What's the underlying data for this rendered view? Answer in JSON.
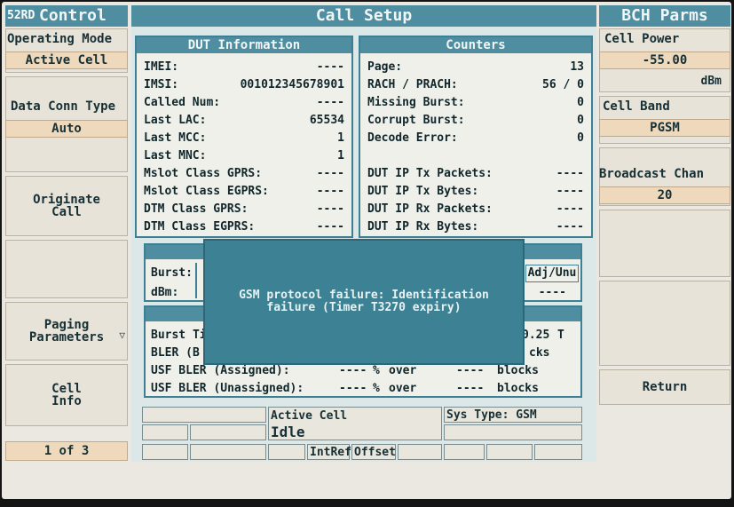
{
  "watermark": "52RD",
  "left": {
    "header": "Control",
    "operating_mode": {
      "title": "Operating Mode",
      "value": "Active Cell"
    },
    "data_conn_type": {
      "title": "Data Conn Type",
      "value": "Auto"
    },
    "originate_call": "Originate\nCall",
    "paging_parameters": "Paging\nParameters",
    "paging_more": "▽",
    "cell_info": "Cell\nInfo",
    "page_indicator": "1 of 3"
  },
  "center": {
    "header": "Call Setup",
    "dut_info": {
      "title": "DUT Information",
      "rows": [
        {
          "label": "IMEI:",
          "value": "----"
        },
        {
          "label": "IMSI:",
          "value": "001012345678901"
        },
        {
          "label": "Called Num:",
          "value": "----"
        },
        {
          "label": "Last LAC:",
          "value": "65534"
        },
        {
          "label": "Last MCC:",
          "value": "1"
        },
        {
          "label": "Last MNC:",
          "value": "1"
        },
        {
          "label": "Mslot Class GPRS:",
          "value": "----"
        },
        {
          "label": "Mslot Class EGPRS:",
          "value": "----"
        },
        {
          "label": "DTM Class GPRS:",
          "value": "----"
        },
        {
          "label": "DTM Class EGPRS:",
          "value": "----"
        }
      ]
    },
    "counters": {
      "title": "Counters",
      "rows": [
        {
          "label": "Page:",
          "value": "13"
        },
        {
          "label": "RACH / PRACH:",
          "value": "56 / 0"
        },
        {
          "label": "Missing Burst:",
          "value": "0"
        },
        {
          "label": "Corrupt Burst:",
          "value": "0"
        },
        {
          "label": "Decode Error:",
          "value": "0"
        },
        {
          "label": "",
          "value": ""
        },
        {
          "label": "DUT IP Tx Packets:",
          "value": "----"
        },
        {
          "label": "DUT IP Tx Bytes:",
          "value": "----"
        },
        {
          "label": "DUT IP Rx Packets:",
          "value": "----"
        },
        {
          "label": "DUT IP Rx Bytes:",
          "value": "----"
        }
      ]
    },
    "mid": {
      "burst_label": "Burst:",
      "dbm_label": "dBm:",
      "adj_label": "Adj/Unu",
      "adj_value": "----"
    },
    "bler": {
      "burst_ti": "Burst Ti",
      "value_025": "0.25",
      "t_unit": "T",
      "bler_b": "BLER (B",
      "blocks1": "cks",
      "usf_assigned": "USF BLER (Assigned):",
      "usf_unassigned": "USF BLER (Unassigned):",
      "dash": "----",
      "pct": "%",
      "over": "over",
      "blocks": "blocks"
    },
    "dialog": {
      "line1": "GSM protocol failure: Identification",
      "line2": "failure (Timer T3270 expiry)"
    }
  },
  "status": {
    "active_cell_label": "Active Cell",
    "active_cell_value": "Idle",
    "sys_type": "Sys Type: GSM",
    "intref": "IntRef",
    "offset": "Offset"
  },
  "right": {
    "header": "BCH Parms",
    "cell_power": {
      "title": "Cell Power",
      "value": "-55.00",
      "unit": "dBm"
    },
    "cell_band": {
      "title": "Cell Band",
      "value": "PGSM"
    },
    "broadcast_chan": {
      "title": "Broadcast Chan",
      "value": "20"
    },
    "return": "Return"
  }
}
